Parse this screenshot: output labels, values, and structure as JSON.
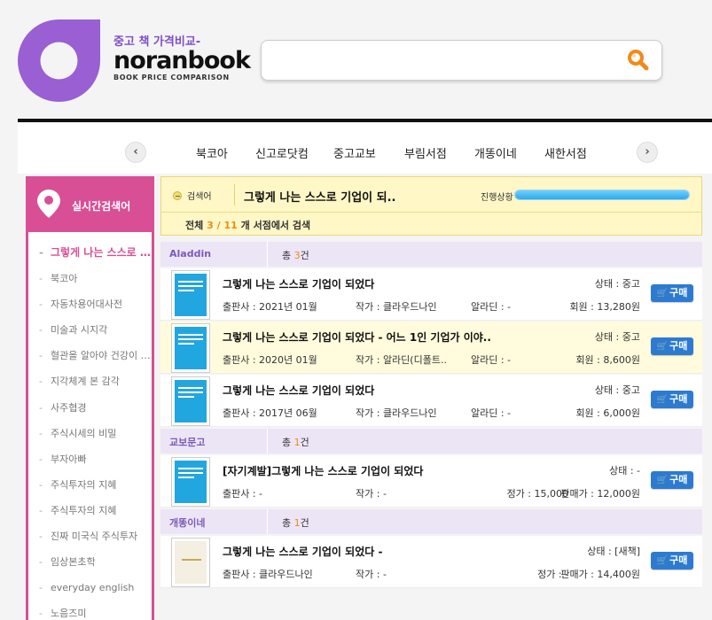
{
  "logo": {
    "tagline": "중고 책 가격비교-",
    "wordmark": "noranbook",
    "subtitle": "BOOK PRICE COMPARISON",
    "brand_color": "#9a5fd3"
  },
  "search": {
    "placeholder": "",
    "value": ""
  },
  "store_nav": {
    "prev_label": "‹",
    "next_label": "›",
    "stores": [
      "북코아",
      "신고로닷컴",
      "중고교보",
      "부림서점",
      "개똥이네",
      "새한서점"
    ]
  },
  "sidebar": {
    "title": "실시간검색어",
    "accent_color": "#d84f96",
    "keywords": [
      "그렇게 나는 스스로 기업이 되었다",
      "북코아",
      "자동차용어대사전",
      "미술과 시지각",
      "혈관을 알아야 건강이 보인다",
      "지각체계 본 감각",
      "사주협경",
      "주식시세의 비밀",
      "부자아빠",
      "주식투자의 지혜",
      "주식투자의 지혜",
      "진짜 미국식 주식투자",
      "임상본초학",
      "everyday english",
      "노음즈미"
    ]
  },
  "status": {
    "query_label": "검색어",
    "query": "그렇게 나는 스스로 기업이 되..",
    "progress_label": "진행상황",
    "progress": 1.0,
    "summary_prefix": "전체",
    "done": "3",
    "sep": "/",
    "total": "11",
    "summary_suffix": "개 서점에서 검색"
  },
  "sections": [
    {
      "store": "Aladdin",
      "count_prefix": "총",
      "count": "3",
      "count_suffix": "건",
      "rows": [
        {
          "title": "그렇게 나는 스스로 기업이 되었다",
          "state": "상태 : 중고",
          "publisher": "출판사 : 2021년 01월",
          "author": "작가 : 클라우드나인",
          "third": "알라딘 : -",
          "price": "회원 : 13,280원",
          "buy": "구매",
          "cover": "blue",
          "highlight": false
        },
        {
          "title": "그렇게 나는 스스로 기업이 되었다 - 어느 1인 기업가 이야..",
          "state": "상태 : 중고",
          "publisher": "출판사 : 2020년 01월",
          "author": "작가 : 알라딘(디폴트..",
          "third": "알라딘 : -",
          "price": "회원 : 8,600원",
          "buy": "구매",
          "cover": "blue",
          "highlight": true
        },
        {
          "title": "그렇게 나는 스스로 기업이 되었다",
          "state": "상태 : 중고",
          "publisher": "출판사 : 2017년 06월",
          "author": "작가 : 클라우드나인",
          "third": "알라딘 : -",
          "price": "회원 : 6,000원",
          "buy": "구매",
          "cover": "blue",
          "highlight": false
        }
      ]
    },
    {
      "store": "교보문고",
      "count_prefix": "총",
      "count": "1",
      "count_suffix": "건",
      "rows": [
        {
          "title": "[자기계발]그렇게 나는 스스로 기업이 되었다",
          "state": "상태 : -",
          "publisher": "출판사 : -",
          "author": "작가 : -",
          "third": "정가 : 15,000",
          "price": "판매가 : 12,000원",
          "buy": "구매",
          "cover": "blue",
          "highlight": false
        }
      ]
    },
    {
      "store": "개똥이네",
      "count_prefix": "총",
      "count": "1",
      "count_suffix": "건",
      "rows": [
        {
          "title": "그렇게 나는 스스로 기업이 되었다 -",
          "state": "상태 : [새책]",
          "publisher": "출판사 : 클라우드나인",
          "author": "작가 : -",
          "third": "정가 : -",
          "price": "판매가 : 14,400원",
          "buy": "구매",
          "cover": "beige",
          "highlight": false
        }
      ]
    }
  ]
}
